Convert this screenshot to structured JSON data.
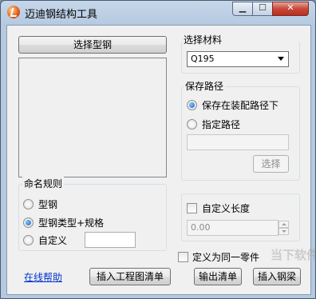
{
  "window": {
    "title": "迈迪钢结构工具",
    "min_symbol": "▁",
    "max_symbol": "☐",
    "close_symbol": "✕"
  },
  "left": {
    "select_button": "选择型钢"
  },
  "material": {
    "label": "选择材料",
    "selected": "Q195"
  },
  "save_path": {
    "label": "保存路径",
    "option_assembly": "保存在装配路径下",
    "option_specify": "指定路径",
    "path_value": "",
    "browse_button": "选择"
  },
  "naming": {
    "label": "命名规则",
    "option_steel": "型钢",
    "option_type_spec": "型钢类型+规格",
    "option_custom": "自定义",
    "custom_value": ""
  },
  "length": {
    "label": "自定义长度",
    "value": "0.00"
  },
  "same_part": {
    "label": "定义为同一零件"
  },
  "footer": {
    "help_link": "在线帮助",
    "insert_drawing_list": "插入工程图清单",
    "output_list": "输出清单",
    "insert_steel": "插入钢梁"
  },
  "watermark": "当下软件园"
}
